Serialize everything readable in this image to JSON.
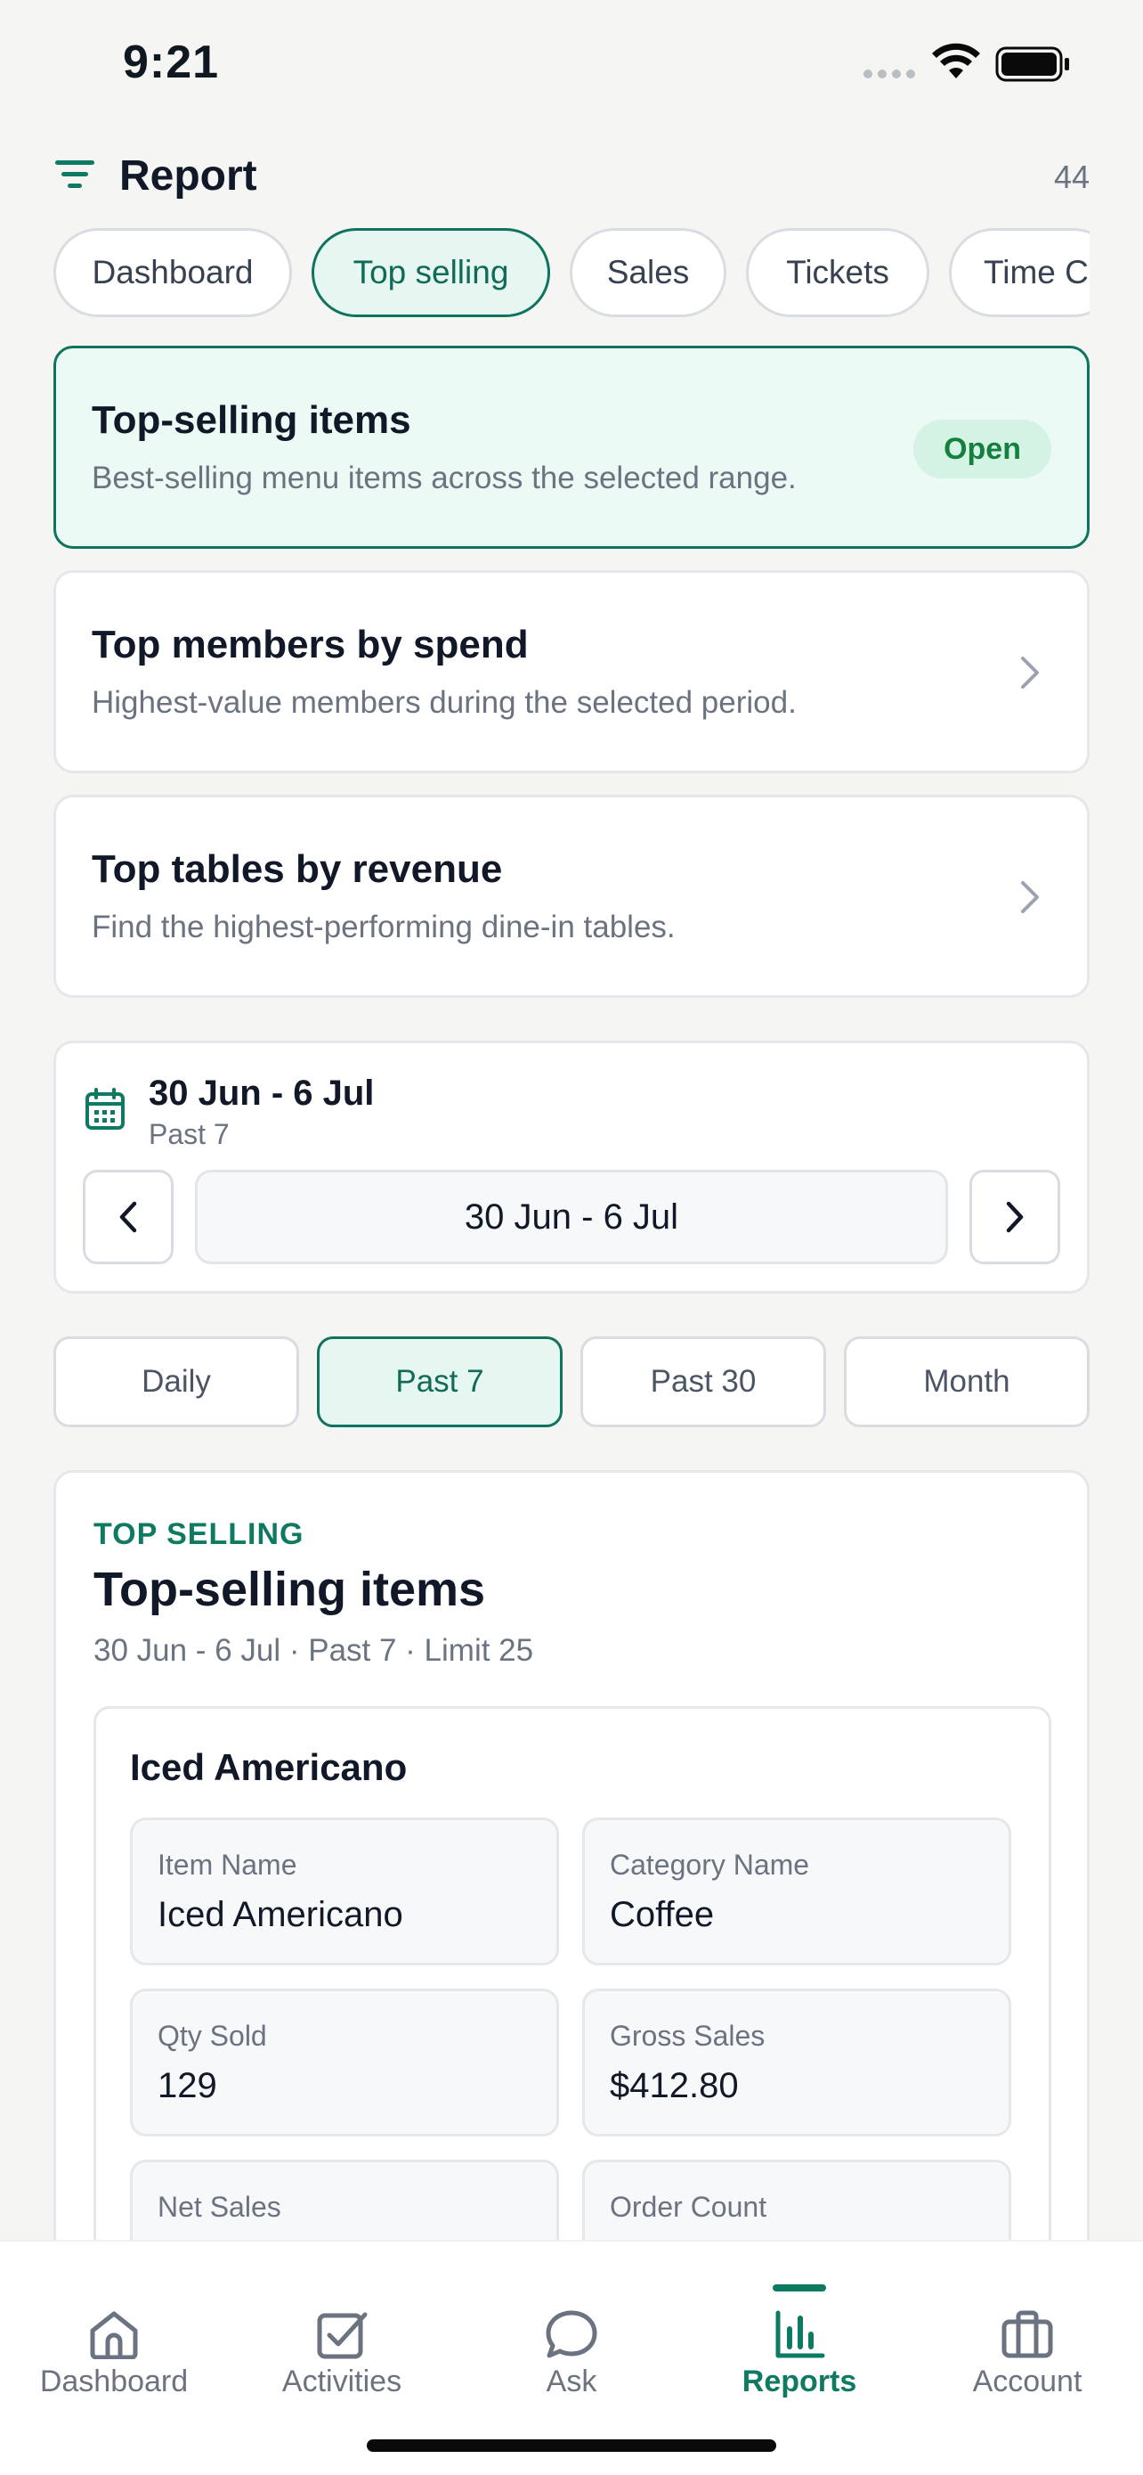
{
  "status_bar": {
    "time": "9:21"
  },
  "header": {
    "title": "Report",
    "count": "44"
  },
  "report_tabs": [
    {
      "label": "Dashboard",
      "active": false
    },
    {
      "label": "Top selling",
      "active": true
    },
    {
      "label": "Sales",
      "active": false
    },
    {
      "label": "Tickets",
      "active": false
    },
    {
      "label": "Time C",
      "active": false
    }
  ],
  "report_cards": [
    {
      "title": "Top-selling items",
      "description": "Best-selling menu items across the selected range.",
      "badge": "Open",
      "active": true
    },
    {
      "title": "Top members by spend",
      "description": "Highest-value members during the selected period.",
      "active": false
    },
    {
      "title": "Top tables by revenue",
      "description": "Find the highest-performing dine-in tables.",
      "active": false
    }
  ],
  "date_range": {
    "title": "30 Jun - 6 Jul",
    "subtitle": "Past 7",
    "pill": "30 Jun - 6 Jul"
  },
  "periods": [
    {
      "label": "Daily",
      "active": false
    },
    {
      "label": "Past 7",
      "active": true
    },
    {
      "label": "Past 30",
      "active": false
    },
    {
      "label": "Month",
      "active": false
    }
  ],
  "results": {
    "eyebrow": "TOP SELLING",
    "title": "Top-selling items",
    "meta": "30 Jun - 6 Jul · Past 7 · Limit 25",
    "items": [
      {
        "name": "Iced Americano",
        "fields": [
          {
            "label": "Item Name",
            "value": "Iced Americano"
          },
          {
            "label": "Category Name",
            "value": "Coffee"
          },
          {
            "label": "Qty Sold",
            "value": "129"
          },
          {
            "label": "Gross Sales",
            "value": "$412.80"
          },
          {
            "label": "Net Sales",
            "value": ""
          },
          {
            "label": "Order Count",
            "value": ""
          }
        ]
      }
    ]
  },
  "tab_bar": [
    {
      "label": "Dashboard",
      "icon": "home-icon",
      "active": false
    },
    {
      "label": "Activities",
      "icon": "checkbox-icon",
      "active": false
    },
    {
      "label": "Ask",
      "icon": "chat-bubble-icon",
      "active": false
    },
    {
      "label": "Reports",
      "icon": "bar-chart-icon",
      "active": true
    },
    {
      "label": "Account",
      "icon": "briefcase-icon",
      "active": false
    }
  ],
  "colors": {
    "accent": "#0f7a62",
    "accent_bg": "#e6f7f1",
    "badge_bg": "#d5f3e4",
    "badge_text": "#15803d"
  }
}
